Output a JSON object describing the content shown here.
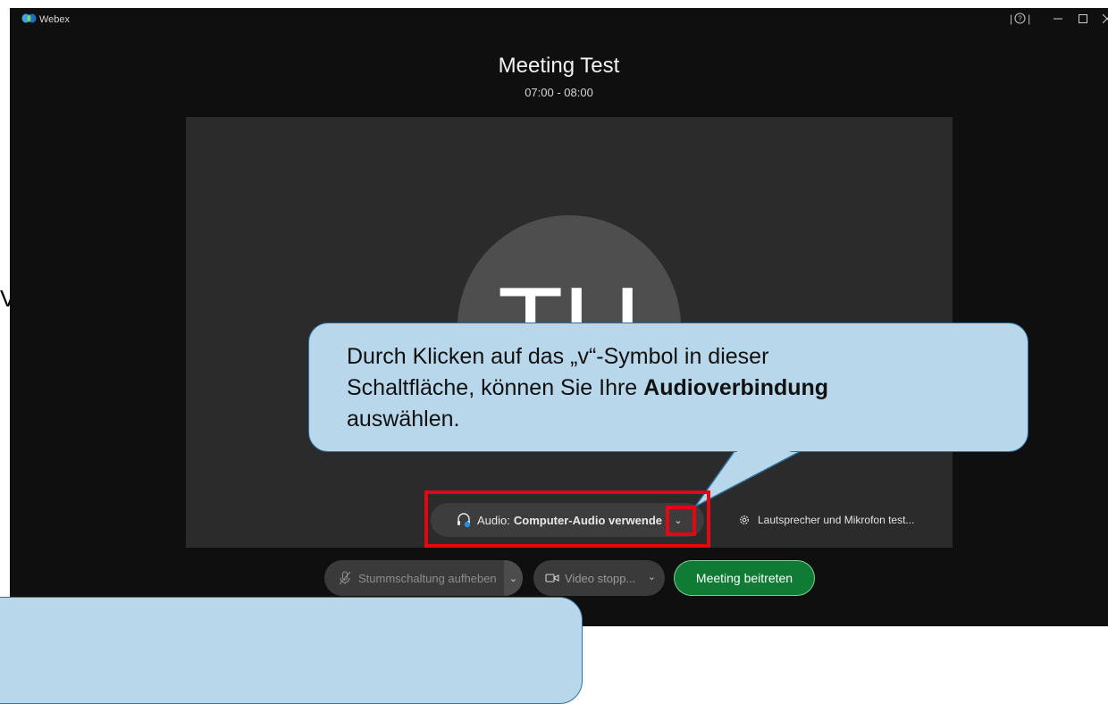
{
  "window": {
    "title": "Webex",
    "help_icon": "help-icon",
    "controls": [
      "minimize-icon",
      "maximize-icon",
      "close-icon"
    ]
  },
  "background_fragment": "V",
  "meeting": {
    "title": "Meeting Test",
    "time": "07:00 - 08:00",
    "avatar_initials": "TU"
  },
  "audio": {
    "prefix": "Audio:",
    "value": "Computer-Audio verwende",
    "chevron": "⌄",
    "test_label": "Lautsprecher und Mikrofon test..."
  },
  "controls": {
    "mute_label": "Stummschaltung aufheben",
    "video_label": "Video stopp...",
    "join_label": "Meeting beitreten",
    "chevron": "⌄"
  },
  "callout": {
    "line1": "Durch Klicken auf das „v“-Symbol in dieser",
    "line2_prefix": "Schaltfläche, können Sie Ihre ",
    "line2_bold": "Audioverbindung",
    "line3": "auswählen."
  },
  "colors": {
    "join_green": "#0f7b34",
    "callout_fill": "#b9d7ea",
    "callout_border": "#2e6f9e",
    "highlight_red": "#e30613"
  }
}
